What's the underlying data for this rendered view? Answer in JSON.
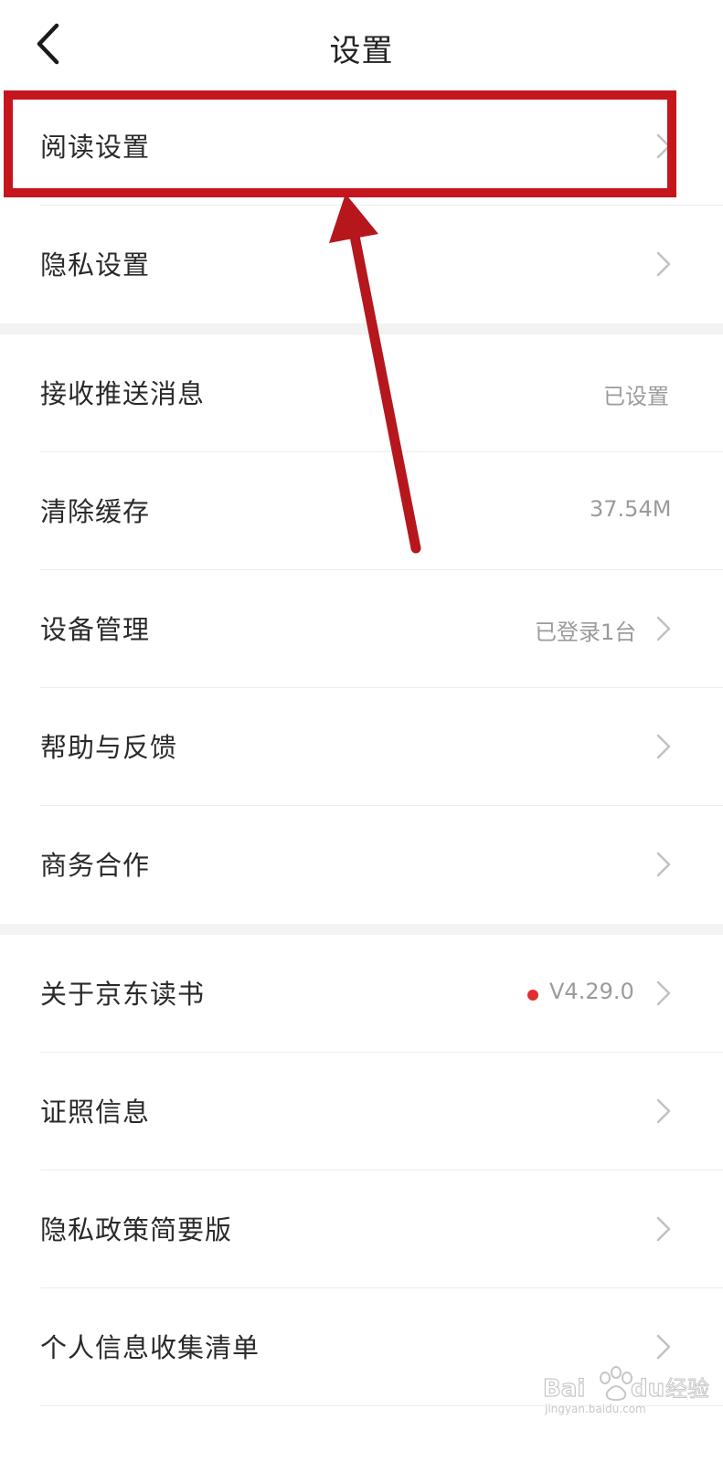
{
  "header": {
    "title": "设置",
    "back_icon": "chevron-left-icon"
  },
  "settings": {
    "reading": {
      "label": "阅读设置"
    },
    "privacy": {
      "label": "隐私设置"
    },
    "push": {
      "label": "接收推送消息",
      "value": "已设置"
    },
    "cache": {
      "label": "清除缓存",
      "value": "37.54M"
    },
    "devices": {
      "label": "设备管理",
      "value": "已登录1台"
    },
    "help": {
      "label": "帮助与反馈"
    },
    "business": {
      "label": "商务合作"
    },
    "about": {
      "label": "关于京东读书",
      "value": "V4.29.0",
      "badge_color": "#e12d2d"
    },
    "license": {
      "label": "证照信息"
    },
    "policy": {
      "label": "隐私政策简要版"
    },
    "personal_info": {
      "label": "个人信息收集清单"
    }
  },
  "annotation": {
    "highlight_color": "#c4161c"
  },
  "watermark": {
    "brand": "Bai",
    "brand_suffix": "du",
    "brand_cn": "经验",
    "url": "jingyan.baidu.com"
  }
}
